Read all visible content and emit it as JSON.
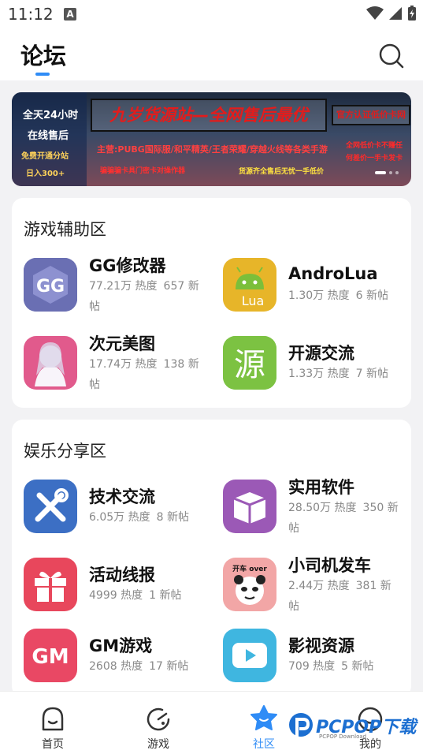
{
  "status_bar": {
    "time": "11:12",
    "notif_letter": "A"
  },
  "header": {
    "title": "论坛"
  },
  "banner": {
    "left_line1": "全天24小时",
    "left_line2": "在线售后",
    "left_line3": "免费开通分站",
    "left_line4": "日入300+",
    "main_title": "九岁货源站—全网售后最优",
    "right_tag": "官方认证低价卡网",
    "mid_line": "主营:PUBG国际服/和平精英/王者荣耀/穿越火线等各类手游",
    "mid_line2": "骗骗骗卡具门密卡对操作器",
    "mid_line3": "货源齐全售后无忧一手低价",
    "right_line": "全网低价卡不赚任何差价一手卡发卡",
    "indicator": {
      "count": 3,
      "active": 0
    }
  },
  "sections": [
    {
      "title": "游戏辅助区",
      "items": [
        {
          "name": "GG修改器",
          "heat": "77.21万 热度",
          "posts": "657 新帖",
          "icon": "gg-icon"
        },
        {
          "name": "AndroLua",
          "heat": "1.30万 热度",
          "posts": "6 新帖",
          "icon": "androlua-icon"
        },
        {
          "name": "次元美图",
          "heat": "17.74万 热度",
          "posts": "138 新帖",
          "icon": "anime-girl-icon"
        },
        {
          "name": "开源交流",
          "heat": "1.33万 热度",
          "posts": "7 新帖",
          "icon": "yuan-icon",
          "icon_text": "源"
        }
      ]
    },
    {
      "title": "娱乐分享区",
      "items": [
        {
          "name": "技术交流",
          "heat": "6.05万 热度",
          "posts": "8 新帖",
          "icon": "tools-icon"
        },
        {
          "name": "实用软件",
          "heat": "28.50万 热度",
          "posts": "350 新帖",
          "icon": "box-icon"
        },
        {
          "name": "活动线报",
          "heat": "4999 热度",
          "posts": "1 新帖",
          "icon": "gift-icon"
        },
        {
          "name": "小司机发车",
          "heat": "2.44万 热度",
          "posts": "381 新帖",
          "icon": "panda-meme-icon",
          "icon_text": "开车 over"
        },
        {
          "name": "GM游戏",
          "heat": "2608 热度",
          "posts": "17 新帖",
          "icon": "gm-icon",
          "icon_text": "GM"
        },
        {
          "name": "影视资源",
          "heat": "709 热度",
          "posts": "5 新帖",
          "icon": "play-icon"
        }
      ]
    }
  ],
  "bottom_nav": [
    {
      "label": "首页",
      "icon": "home-icon"
    },
    {
      "label": "游戏",
      "icon": "game-icon"
    },
    {
      "label": "社区",
      "icon": "community-star-icon",
      "active": true
    },
    {
      "label": "我的",
      "icon": "profile-icon"
    }
  ],
  "watermark": {
    "text": "PCPOP下载",
    "sub": "PCPOP Download"
  },
  "colors": {
    "accent": "#2f8cf6"
  }
}
